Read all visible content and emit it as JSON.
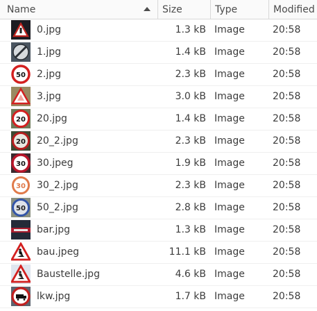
{
  "columns": {
    "name": "Name",
    "size": "Size",
    "type": "Type",
    "modified": "Modified"
  },
  "files": [
    {
      "name": "0.jpg",
      "size": "1.3 kB",
      "type": "Image",
      "modified": "20:58",
      "thumb": "triangle-dark-icon"
    },
    {
      "name": "1.jpg",
      "size": "1.4 kB",
      "type": "Image",
      "modified": "20:58",
      "thumb": "end-limit-sign-icon"
    },
    {
      "name": "2.jpg",
      "size": "2.3 kB",
      "type": "Image",
      "modified": "20:58",
      "thumb": "speed-50-sign-icon"
    },
    {
      "name": "3.jpg",
      "size": "3.0 kB",
      "type": "Image",
      "modified": "20:58",
      "thumb": "warning-triangle-icon"
    },
    {
      "name": "20.jpg",
      "size": "1.4 kB",
      "type": "Image",
      "modified": "20:58",
      "thumb": "speed-20-sign-icon"
    },
    {
      "name": "20_2.jpg",
      "size": "2.3 kB",
      "type": "Image",
      "modified": "20:58",
      "thumb": "speed-20-sign-icon"
    },
    {
      "name": "30.jpeg",
      "size": "1.9 kB",
      "type": "Image",
      "modified": "20:58",
      "thumb": "speed-30-sign-icon"
    },
    {
      "name": "30_2.jpg",
      "size": "2.3 kB",
      "type": "Image",
      "modified": "20:58",
      "thumb": "speed-30-sign-icon"
    },
    {
      "name": "50_2.jpg",
      "size": "2.8 kB",
      "type": "Image",
      "modified": "20:58",
      "thumb": "speed-50-sign-icon"
    },
    {
      "name": "bar.jpg",
      "size": "1.3 kB",
      "type": "Image",
      "modified": "20:58",
      "thumb": "no-entry-sign-icon"
    },
    {
      "name": "bau.jpeg",
      "size": "11.1 kB",
      "type": "Image",
      "modified": "20:58",
      "thumb": "roadworks-sign-icon"
    },
    {
      "name": "Baustelle.jpg",
      "size": "4.6 kB",
      "type": "Image",
      "modified": "20:58",
      "thumb": "roadworks-sign-icon"
    },
    {
      "name": "lkw.jpg",
      "size": "1.7 kB",
      "type": "Image",
      "modified": "20:58",
      "thumb": "no-trucks-sign-icon"
    }
  ],
  "thumb_labels": {
    "t2": "50",
    "t4": "20",
    "t5": "20",
    "t6": "30",
    "t7": "30",
    "t8": "50"
  }
}
